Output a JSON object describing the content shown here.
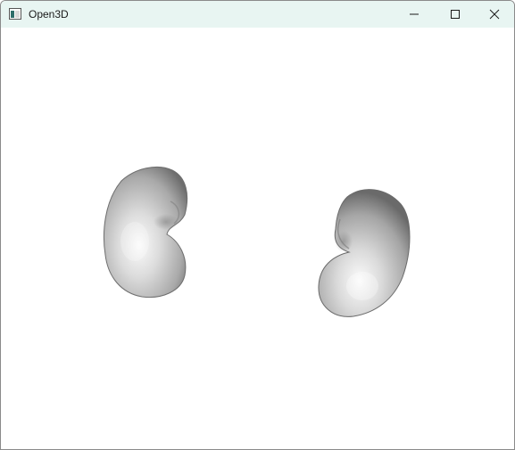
{
  "window": {
    "title": "Open3D",
    "icon": "open3d-app-icon",
    "controls": {
      "minimize_icon": "minimize-icon",
      "maximize_icon": "maximize-icon",
      "close_icon": "close-icon"
    }
  },
  "scene": {
    "background": "#ffffff",
    "objects": [
      {
        "name": "kidney-mesh-left",
        "color": "#d6d6d6"
      },
      {
        "name": "kidney-mesh-right",
        "color": "#d6d6d6"
      }
    ]
  },
  "colors": {
    "titlebar": "#e8f5f2",
    "mesh_highlight": "#f5f5f5",
    "mesh_shadow": "#6e6e6e"
  }
}
